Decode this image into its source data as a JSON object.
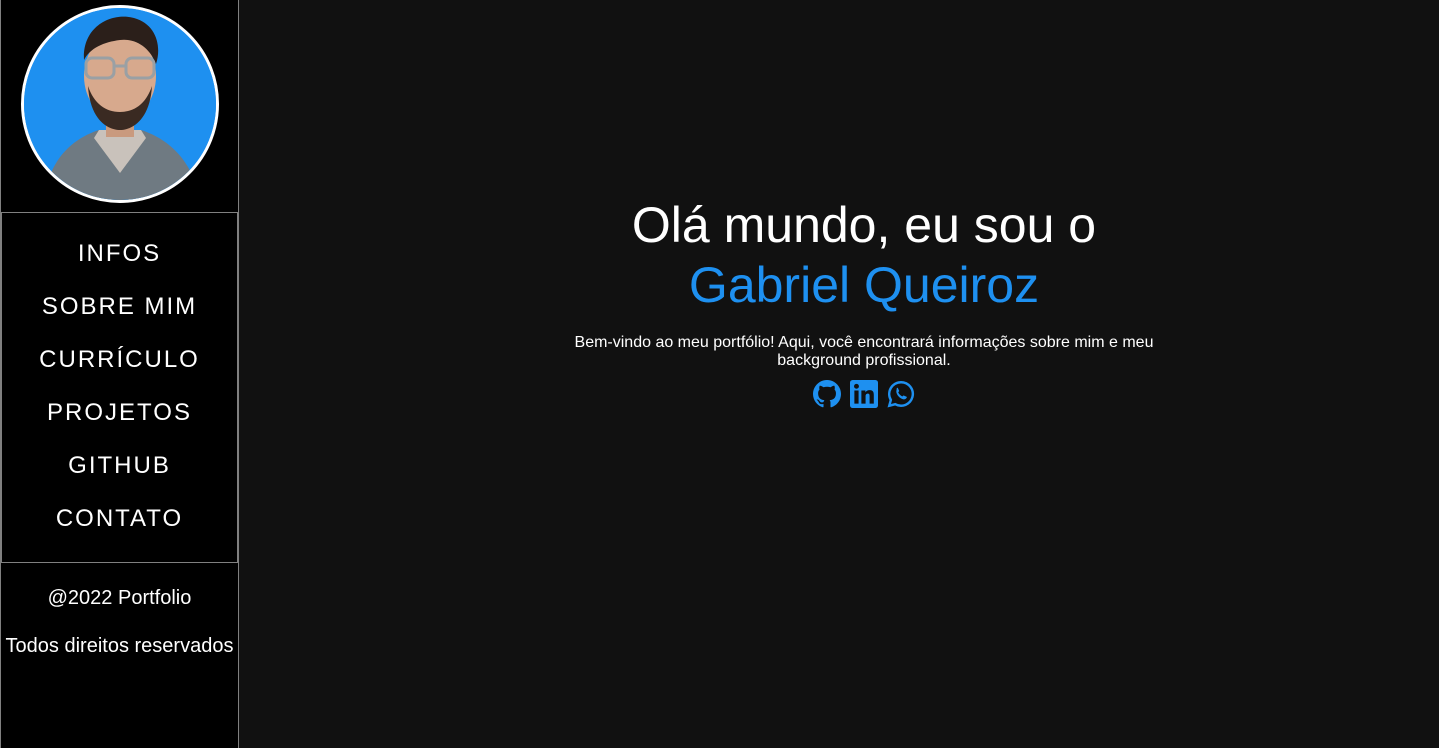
{
  "sidebar": {
    "avatar_alt": "Gabriel Queiroz",
    "nav": [
      {
        "label": "INFOS"
      },
      {
        "label": "SOBRE MIM"
      },
      {
        "label": "CURRÍCULO"
      },
      {
        "label": "PROJETOS"
      },
      {
        "label": "GITHUB"
      },
      {
        "label": "CONTATO"
      }
    ],
    "footer": {
      "copyright": "@2022 Portfolio",
      "rights": "Todos direitos reservados"
    }
  },
  "hero": {
    "headline": "Olá mundo, eu sou o",
    "name": "Gabriel Queiroz",
    "description": "Bem-vindo ao meu portfólio! Aqui, você encontrará informações sobre mim e meu background profissional.",
    "socials": [
      {
        "icon": "github-icon"
      },
      {
        "icon": "linkedin-icon"
      },
      {
        "icon": "whatsapp-icon"
      }
    ]
  },
  "colors": {
    "accent": "#1e90f0",
    "background": "#111111",
    "sidebar": "#000000",
    "text": "#ffffff"
  }
}
